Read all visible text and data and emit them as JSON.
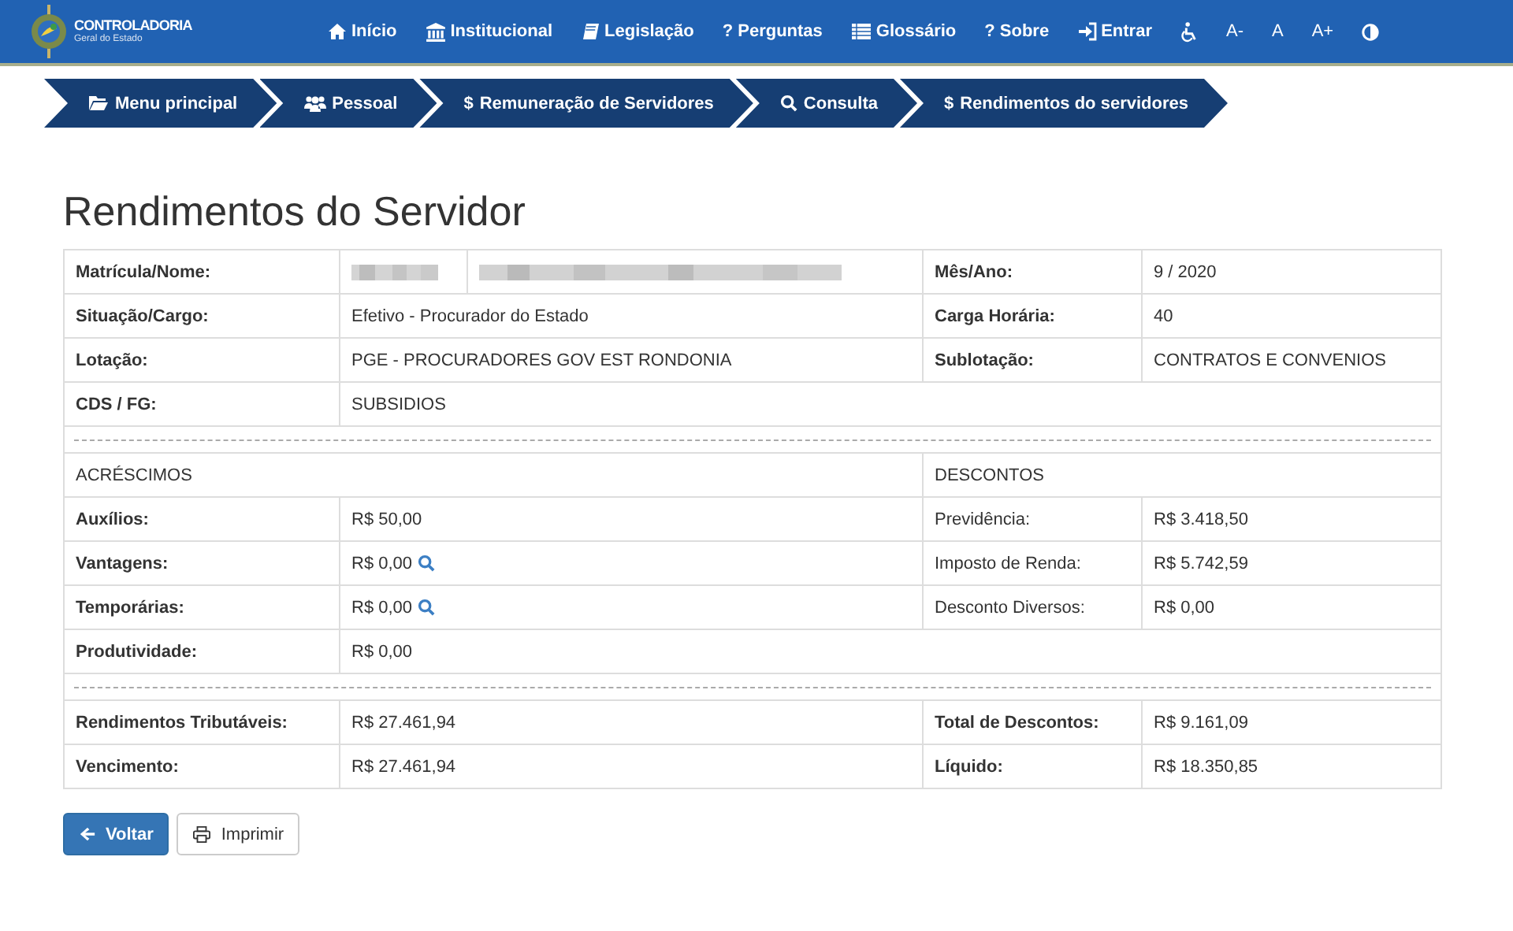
{
  "header": {
    "logo": {
      "title": "CONTROLADORIA",
      "subtitle": "Geral do Estado"
    },
    "nav": [
      {
        "label": "Início"
      },
      {
        "label": "Institucional"
      },
      {
        "label": "Legislação"
      },
      {
        "glyph": "?",
        "label": "Perguntas"
      },
      {
        "label": "Glossário"
      },
      {
        "glyph": "?",
        "label": "Sobre"
      },
      {
        "label": "Entrar"
      }
    ],
    "accessibility": [
      {
        "kind": "icon"
      },
      {
        "kind": "text",
        "label": "A-"
      },
      {
        "kind": "text",
        "label": "A"
      },
      {
        "kind": "text",
        "label": "A+"
      },
      {
        "kind": "icon"
      }
    ]
  },
  "breadcrumbs": [
    {
      "label": "Menu principal"
    },
    {
      "label": "Pessoal"
    },
    {
      "glyph": "$",
      "label": "Remuneração de Servidores"
    },
    {
      "label": "Consulta"
    },
    {
      "glyph": "$",
      "label": "Rendimentos do servidores"
    }
  ],
  "title": "Rendimentos do Servidor",
  "identification": [
    {
      "kind": "redacted",
      "label": "Matrícula/Nome:",
      "right_label": "Mês/Ano:",
      "right_value": "9 / 2020"
    },
    {
      "kind": "text",
      "label": "Situação/Cargo:",
      "value": "Efetivo - Procurador do Estado",
      "right_label": "Carga Horária:",
      "right_value": "40"
    },
    {
      "kind": "text",
      "label": "Lotação:",
      "value": "PGE - PROCURADORES GOV EST RONDONIA",
      "right_label": "Sublotação:",
      "right_value": "CONTRATOS E CONVENIOS"
    },
    {
      "kind": "text",
      "label": "CDS / FG:",
      "value": "SUBSIDIOS"
    }
  ],
  "sections": {
    "left": "ACRÉSCIMOS",
    "right": "DESCONTOS"
  },
  "items": [
    {
      "label": "Auxílios:",
      "value": "R$ 50,00",
      "detail": false,
      "right_label": "Previdência:",
      "right_value": "R$ 3.418,50"
    },
    {
      "label": "Vantagens:",
      "value": "R$ 0,00",
      "detail": true,
      "right_label": "Imposto de Renda:",
      "right_value": "R$ 5.742,59"
    },
    {
      "label": "Temporárias:",
      "value": "R$ 0,00",
      "detail": true,
      "right_label": "Desconto Diversos:",
      "right_value": "R$ 0,00"
    },
    {
      "label": "Produtividade:",
      "value": "R$ 0,00",
      "detail": false
    }
  ],
  "totals": [
    {
      "label": "Rendimentos Tributáveis:",
      "value": "R$ 27.461,94",
      "right_label": "Total de Descontos:",
      "right_value": "R$ 9.161,09"
    },
    {
      "label": "Vencimento:",
      "value": "R$ 27.461,94",
      "right_label": "Líquido:",
      "right_value": "R$ 18.350,85"
    }
  ],
  "buttons": [
    {
      "kind": "primary",
      "label": "Voltar"
    },
    {
      "kind": "default",
      "label": "Imprimir"
    }
  ]
}
